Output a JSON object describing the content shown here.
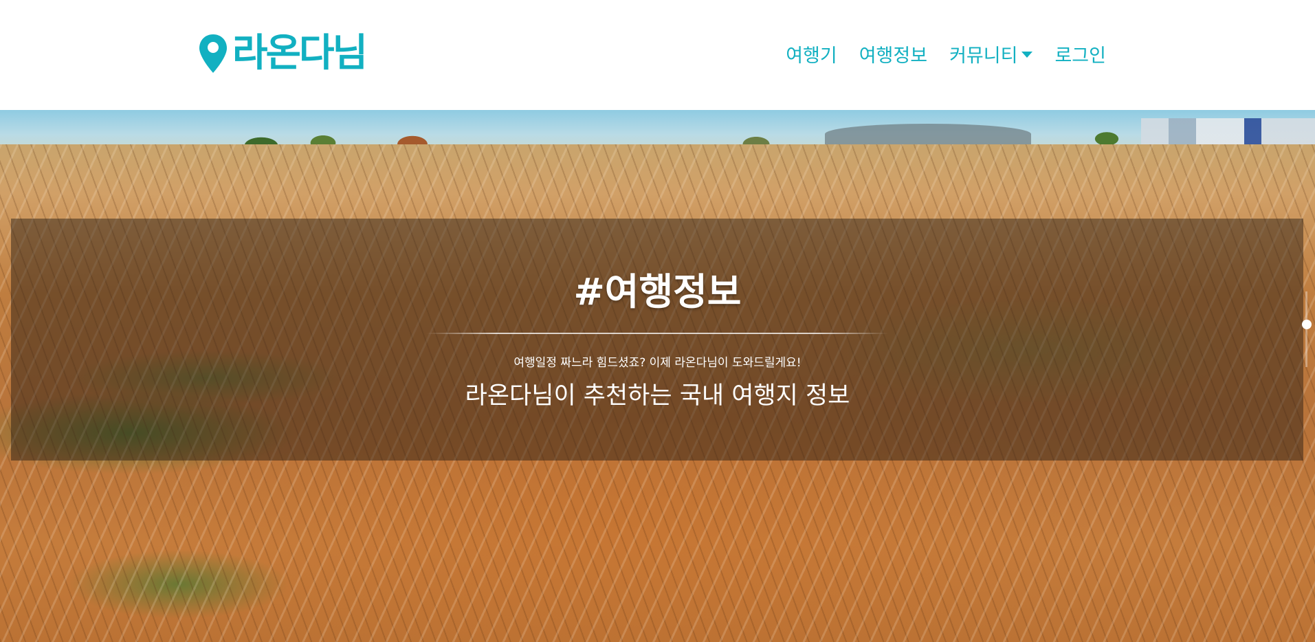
{
  "header": {
    "brand_text": "라온다님",
    "nav": [
      {
        "label": "여행기",
        "has_dropdown": false
      },
      {
        "label": "여행정보",
        "has_dropdown": false
      },
      {
        "label": "커뮤니티",
        "has_dropdown": true
      },
      {
        "label": "로그인",
        "has_dropdown": false
      }
    ]
  },
  "hero": {
    "title": "#여행정보",
    "subtitle": "여행일정 짜느라 힘드셨죠? 이제 라온다님이 도와드릴게요!",
    "lead": "라온다님이 추천하는 국내 여행지 정보"
  },
  "colors": {
    "brand": "#12b0c1",
    "overlay": "rgba(40, 30, 20, 0.48)",
    "hero_text": "#ffffff"
  },
  "icons": {
    "brand_icon": "map-pin-icon",
    "dropdown_icon": "caret-down-icon"
  }
}
